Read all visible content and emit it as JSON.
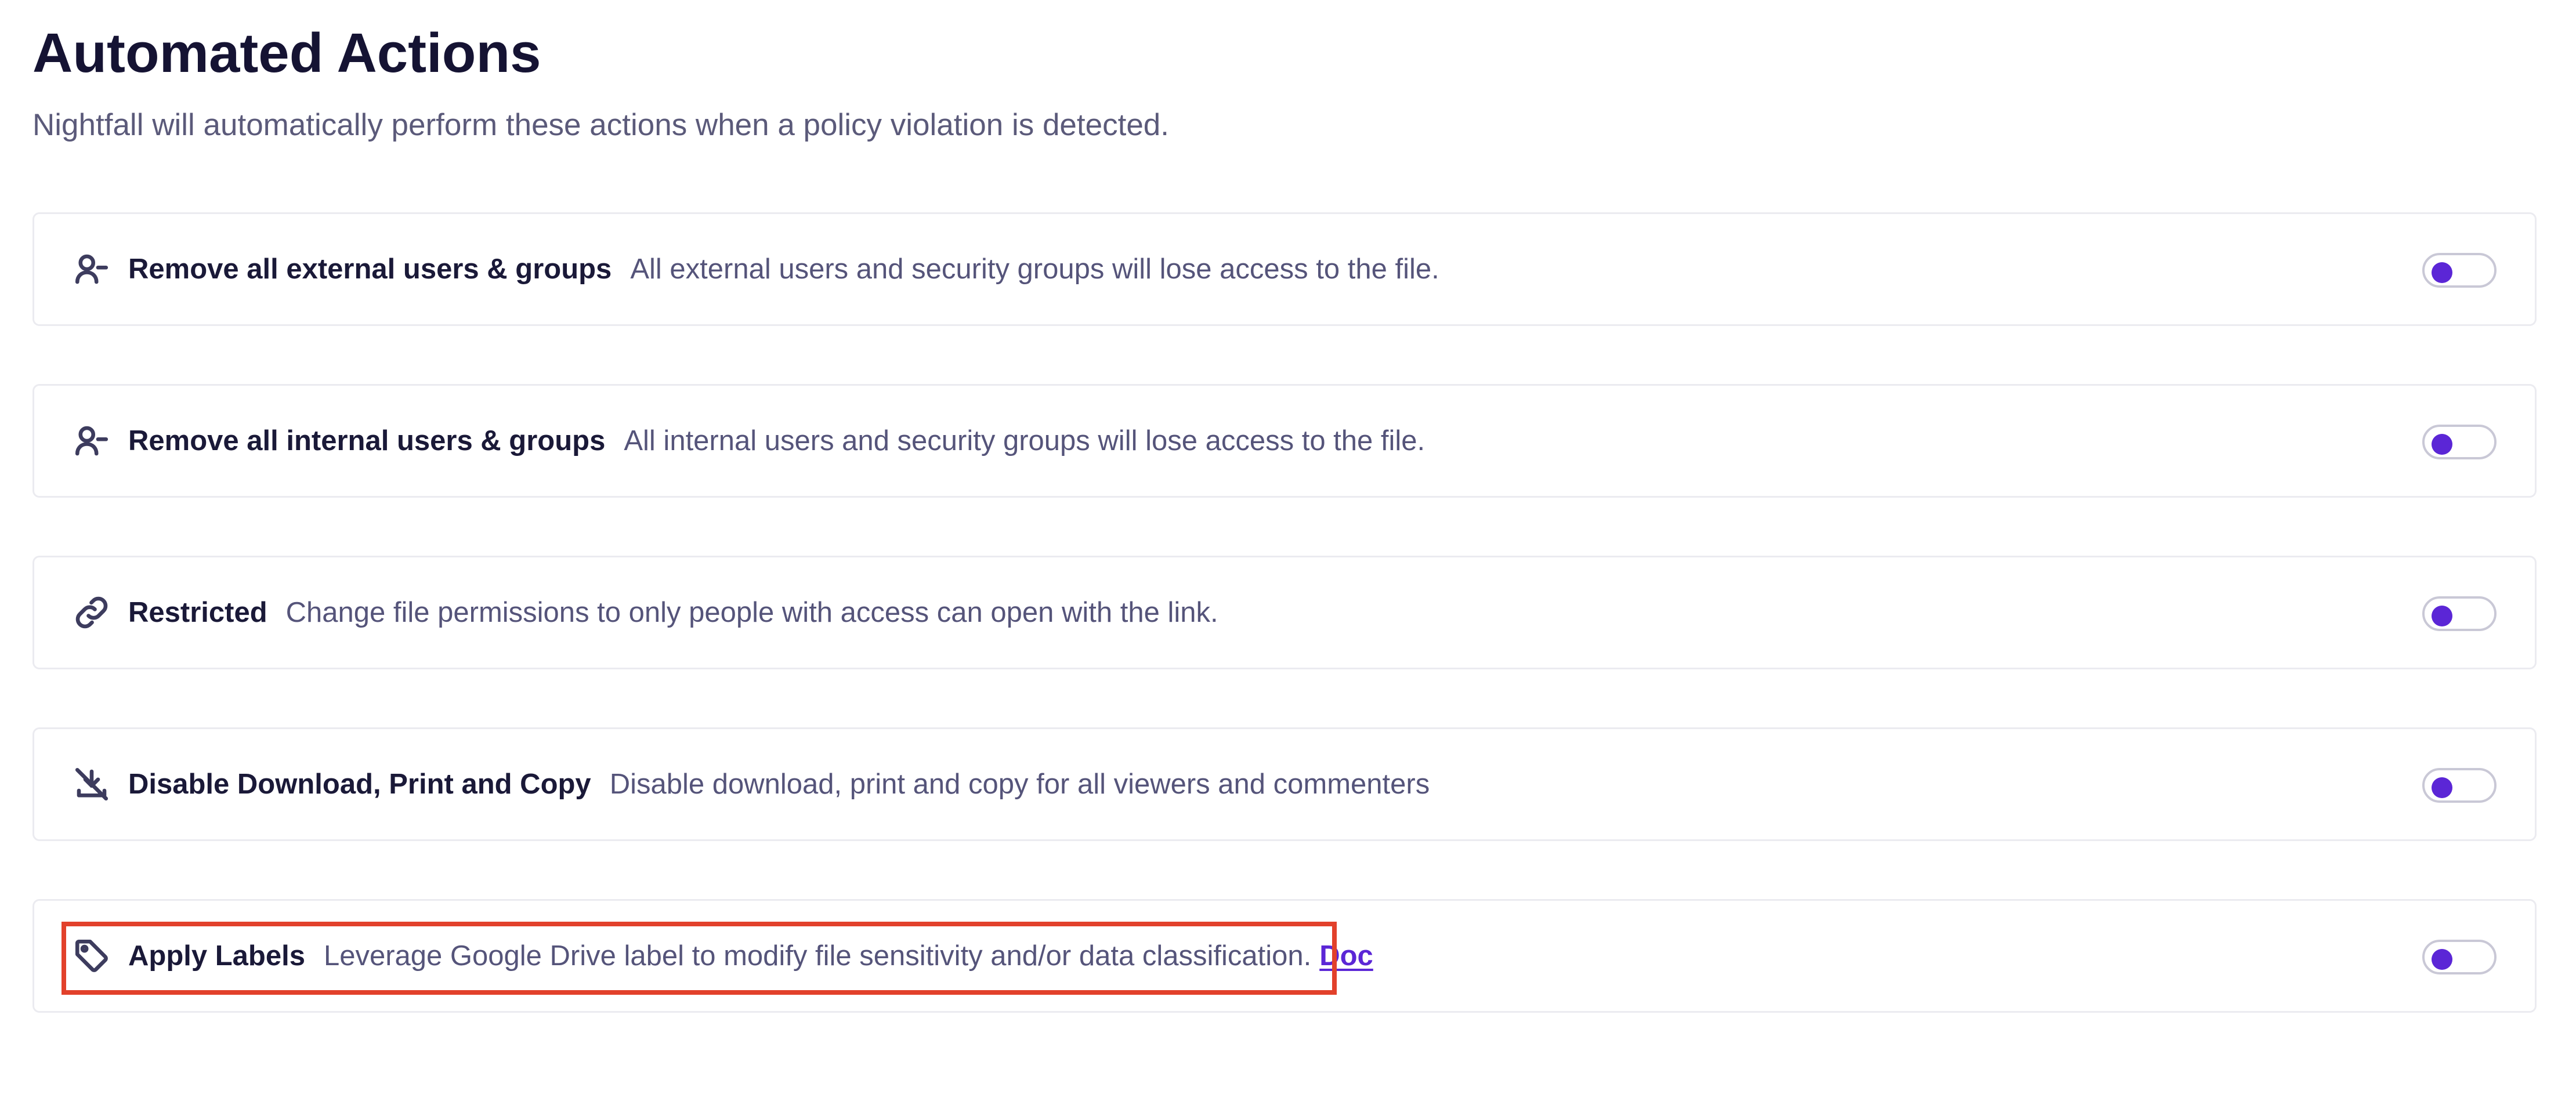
{
  "header": {
    "title": "Automated Actions",
    "subtitle": "Nightfall will automatically perform these actions when a policy violation is detected."
  },
  "actions": [
    {
      "icon": "user-minus-icon",
      "title": "Remove all external users & groups",
      "description": "All external users and security groups will lose access to the file.",
      "enabled": false
    },
    {
      "icon": "user-minus-icon",
      "title": "Remove all internal users & groups",
      "description": "All internal users and security groups will lose access to the file.",
      "enabled": false
    },
    {
      "icon": "link-icon",
      "title": "Restricted",
      "description": "Change file permissions to only people with access can open with the link.",
      "enabled": false
    },
    {
      "icon": "download-off-icon",
      "title": "Disable Download, Print and Copy",
      "description": "Disable download, print and copy for all viewers and commenters",
      "enabled": false
    },
    {
      "icon": "tag-icon",
      "title": "Apply Labels",
      "description": "Leverage Google Drive label to modify file sensitivity and/or data classification.",
      "link_label": "Doc",
      "enabled": false
    }
  ],
  "colors": {
    "accent": "#5b26d6",
    "highlight": "#e2412b",
    "card_border": "#ebebf0"
  }
}
